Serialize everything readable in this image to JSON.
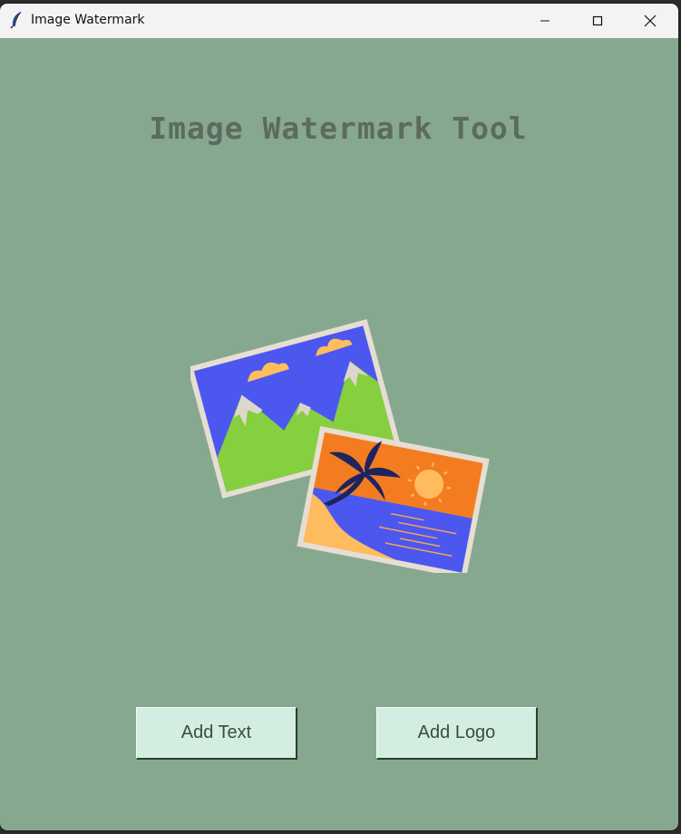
{
  "window": {
    "title": "Image Watermark",
    "icon": "feather-icon",
    "controls": [
      "minimize-icon",
      "maximize-icon",
      "close-icon"
    ]
  },
  "main": {
    "heading": "Image Watermark Tool",
    "illustration": "photos-icon",
    "buttons": {
      "add_text": "Add Text",
      "add_logo": "Add Logo"
    }
  },
  "colors": {
    "background": "#86a88f",
    "heading": "#5c6b5e",
    "button_bg": "#d3eee0",
    "titlebar": "#f3f3f3"
  }
}
